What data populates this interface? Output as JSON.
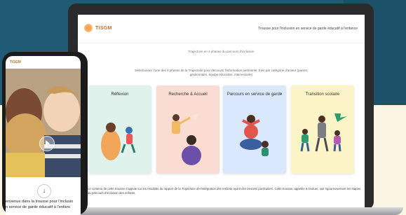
{
  "site": {
    "logo": "TISGM",
    "header_title": "Trousse pour l'inclusion en service de garde éducatif à l'enfance",
    "subtitle": "Trajectoire en 4 phases du parcours d'inclusion",
    "instructions": "Sélectionnez l'une des 4 phases de la Trajectoire pour découvrir l'information pertinente, triée par catégorie d'acteur (parent, gestionnaire, équipe éducative, intervenante)",
    "cards": [
      {
        "label": "Réflexion",
        "color": "#dff3ec"
      },
      {
        "label": "Recherche & Accueil",
        "color": "#fadcd3"
      },
      {
        "label": "Parcours en service de garde",
        "color": "#d9e8fb"
      },
      {
        "label": "Transition scolaire",
        "color": "#fbf4c7"
      }
    ],
    "footer_prefix": "Le contenu de cette trousse s'appuie sur les résultats du rapport de la ",
    "footer_italic": "Trajectoire de l'intégration des enfants ayant des besoins particuliers",
    "footer_suffix": ". Cette trousse, appelée à évoluer, suit rigoureusement les étapes du parcours d'inclusion des enfants."
  },
  "phone": {
    "logo": "TISGM",
    "welcome_line1": "envenue dans la trousse pour l'inclusio",
    "welcome_line2": "n service de garde éducatif à l'enfanc"
  }
}
